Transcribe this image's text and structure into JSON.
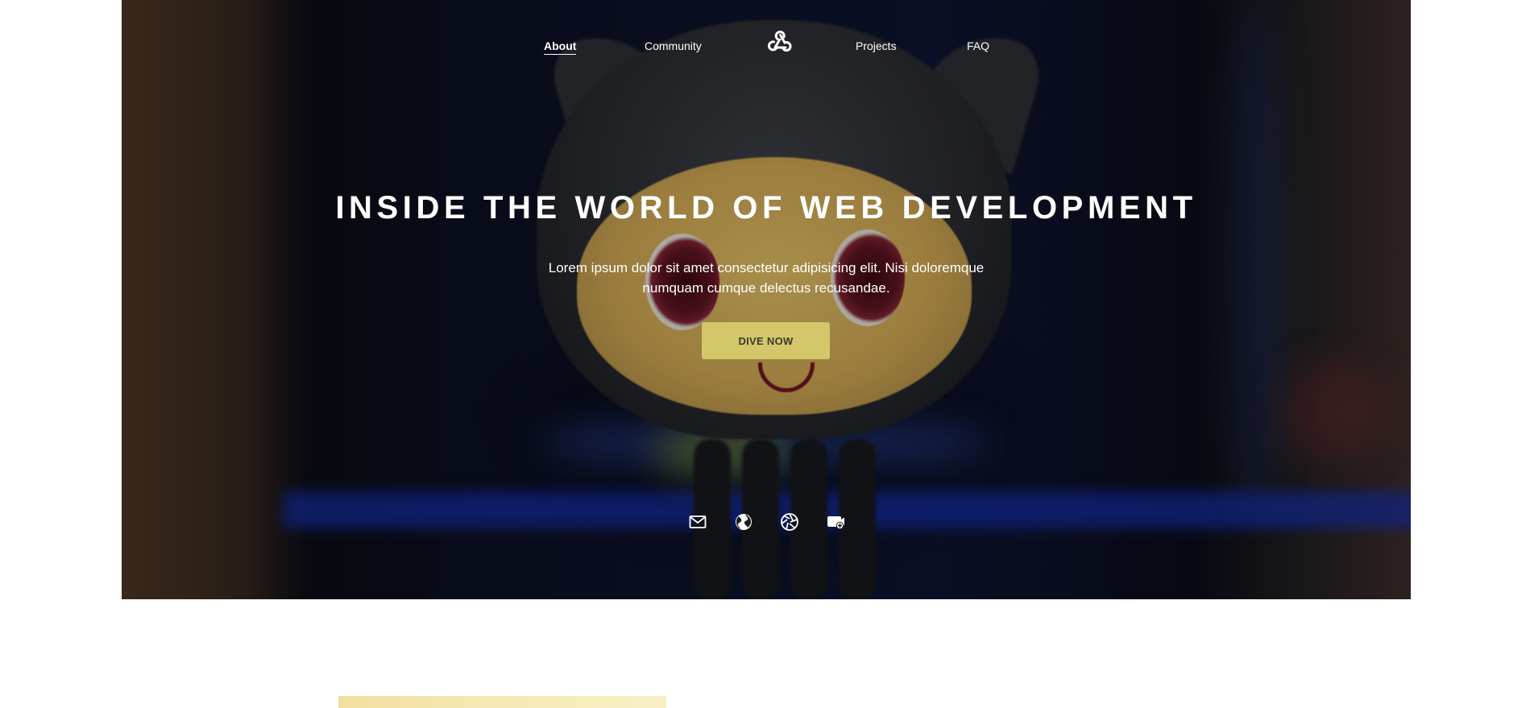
{
  "nav": {
    "items": [
      {
        "label": "About",
        "active": true
      },
      {
        "label": "Community",
        "active": false
      },
      {
        "label": "Projects",
        "active": false
      },
      {
        "label": "FAQ",
        "active": false
      }
    ],
    "logo_icon": "webhook-logo-icon"
  },
  "hero": {
    "title": "INSIDE THE WORLD OF WEB DEVELOPMENT",
    "text": "Lorem ipsum dolor sit amet consectetur adipisicing elit. Nisi doloremque numquam cumque delectus recusandae.",
    "cta_label": "DIVE NOW",
    "cta_color": "#d4c76a"
  },
  "social": [
    {
      "icon": "mail-icon"
    },
    {
      "icon": "globe-icon"
    },
    {
      "icon": "aperture-icon"
    },
    {
      "icon": "video-add-icon"
    }
  ]
}
